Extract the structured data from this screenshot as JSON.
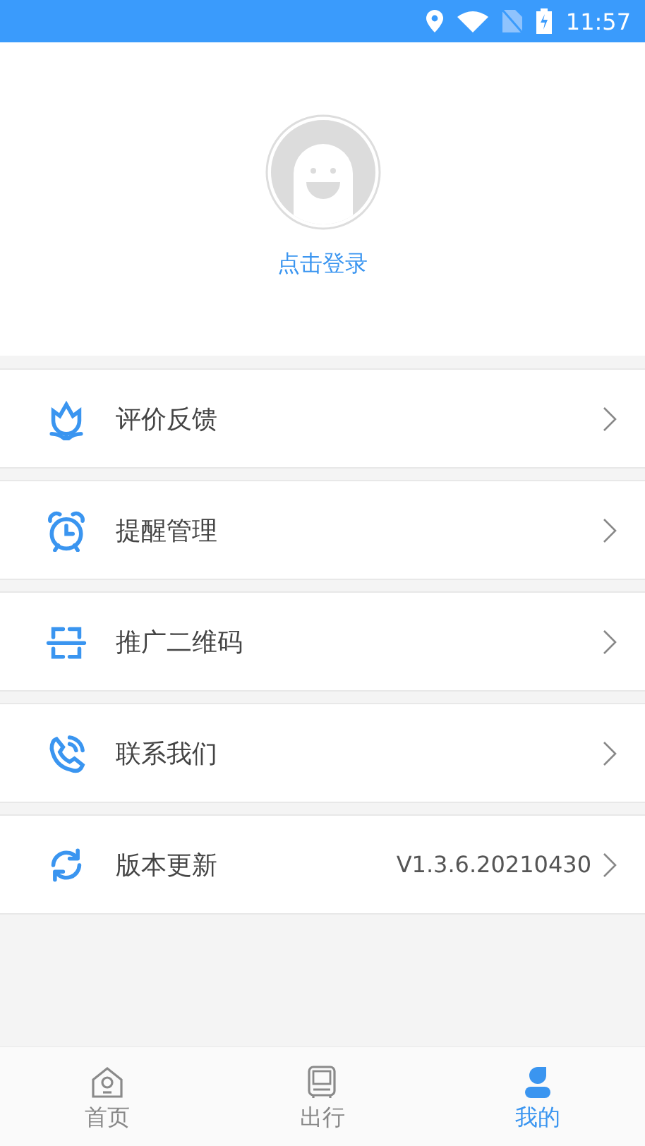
{
  "status_bar": {
    "time": "11:57"
  },
  "profile": {
    "login_label": "点击登录"
  },
  "menu": [
    {
      "kind": "flower",
      "label": "评价反馈"
    },
    {
      "kind": "alarm",
      "label": "提醒管理"
    },
    {
      "kind": "scan",
      "label": "推广二维码"
    },
    {
      "kind": "phone",
      "label": "联系我们"
    },
    {
      "kind": "refresh",
      "label": "版本更新",
      "value": "V1.3.6.20210430"
    }
  ],
  "tabs": [
    {
      "kind": "home",
      "label": "首页",
      "selected": false
    },
    {
      "kind": "bus",
      "label": "出行",
      "selected": false
    },
    {
      "kind": "person",
      "label": "我的",
      "selected": true
    }
  ]
}
